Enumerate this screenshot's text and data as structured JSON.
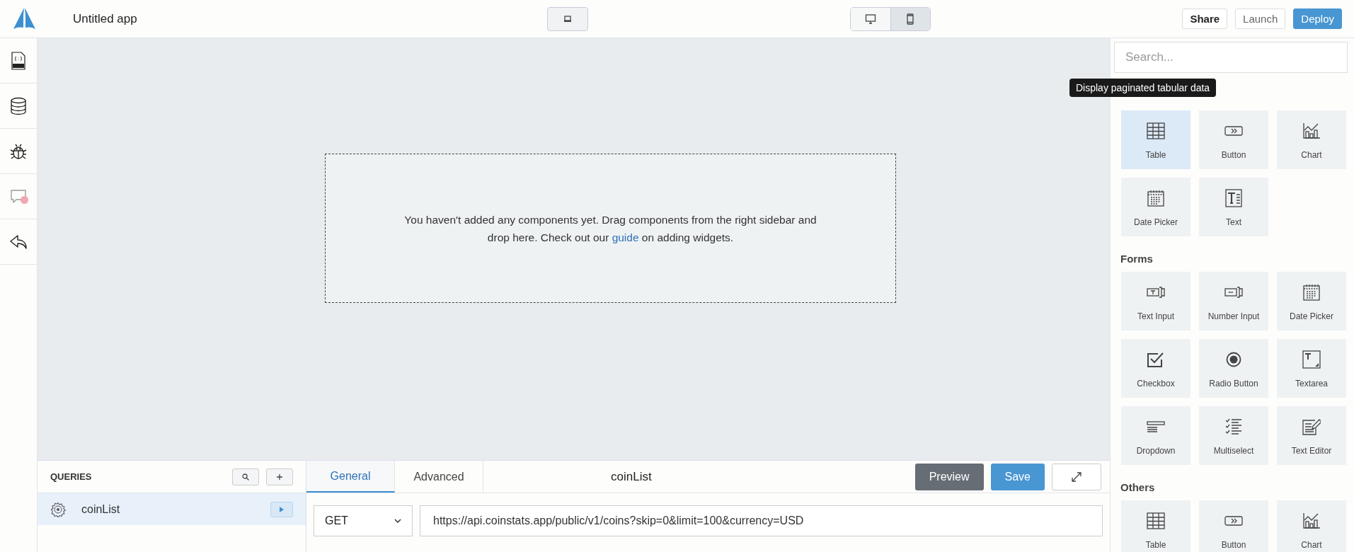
{
  "app": {
    "title": "Untitled app"
  },
  "layout_button": {
    "kind": "laptop"
  },
  "devices": [
    {
      "kind": "desktop",
      "selected": false
    },
    {
      "kind": "mobile",
      "selected": true
    }
  ],
  "actions": [
    {
      "label": "Share",
      "kind": "outline"
    },
    {
      "label": "Launch",
      "kind": "muted"
    },
    {
      "label": "Deploy",
      "kind": "primary"
    }
  ],
  "sidebar": {
    "items": [
      {
        "kind": "json",
        "notification": false
      },
      {
        "kind": "database",
        "notification": false
      },
      {
        "kind": "bug",
        "notification": false
      },
      {
        "kind": "comments",
        "notification": true
      },
      {
        "kind": "undo",
        "notification": false
      }
    ]
  },
  "canvas": {
    "message_start": "You haven't added any components yet. Drag components from the right sidebar and drop here. Check out our ",
    "link": "guide",
    "message_end": " on adding widgets."
  },
  "widgets": {
    "search": {
      "placeholder": "Search..."
    },
    "tooltip": "Display paginated tabular data",
    "sections": [
      {
        "items": [
          {
            "label": "Table",
            "kind": "table",
            "hovered": true
          },
          {
            "label": "Button",
            "kind": "button",
            "hovered": false
          },
          {
            "label": "Chart",
            "kind": "chart",
            "hovered": false
          },
          {
            "label": "Date Picker",
            "kind": "date",
            "hovered": false
          },
          {
            "label": "Text",
            "kind": "text",
            "hovered": false
          }
        ]
      },
      {
        "title": "Forms",
        "items": [
          {
            "label": "Text Input",
            "kind": "textinput",
            "hovered": false
          },
          {
            "label": "Number Input",
            "kind": "numberinput",
            "hovered": false
          },
          {
            "label": "Date Picker",
            "kind": "date",
            "hovered": false
          },
          {
            "label": "Checkbox",
            "kind": "checkbox",
            "hovered": false
          },
          {
            "label": "Radio Button",
            "kind": "radio",
            "hovered": false
          },
          {
            "label": "Textarea",
            "kind": "textarea",
            "hovered": false
          },
          {
            "label": "Dropdown",
            "kind": "dropdown",
            "hovered": false
          },
          {
            "label": "Multiselect",
            "kind": "multiselect",
            "hovered": false
          },
          {
            "label": "Text Editor",
            "kind": "editor",
            "hovered": false
          }
        ]
      },
      {
        "title": "Others",
        "items": [
          {
            "label": "Table",
            "kind": "table",
            "hovered": false
          },
          {
            "label": "Button",
            "kind": "button",
            "hovered": false
          },
          {
            "label": "Chart",
            "kind": "chart",
            "hovered": false
          }
        ]
      }
    ]
  },
  "queries": {
    "title": "QUERIES",
    "items": [
      {
        "name": "coinList",
        "selected": true
      }
    ]
  },
  "editor": {
    "tabs": [
      {
        "label": "General",
        "selected": true
      },
      {
        "label": "Advanced",
        "selected": false
      }
    ],
    "query_name": "coinList",
    "buttons": [
      {
        "label": "Preview",
        "kind": "dark"
      },
      {
        "label": "Save",
        "kind": "primary"
      },
      {
        "kind": "expand"
      }
    ],
    "method": "GET",
    "url": "https://api.coinstats.app/public/v1/coins?skip=0&limit=100&currency=USD"
  }
}
